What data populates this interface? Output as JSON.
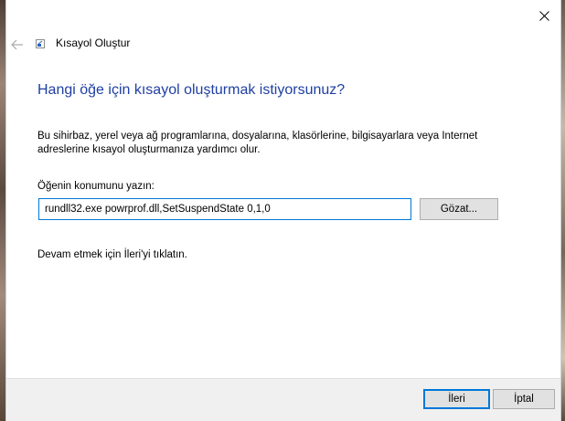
{
  "window": {
    "title": "Kısayol Oluştur"
  },
  "main": {
    "heading": "Hangi öğe için kısayol oluşturmak istiyorsunuz?",
    "description": "Bu sihirbaz, yerel veya ağ programlarına, dosyalarına, klasörlerine, bilgisayarlara veya Internet adreslerine kısayol oluşturmanıza yardımcı olur.",
    "location_label": "Öğenin konumunu yazın:",
    "location_value": "rundll32.exe powrprof.dll,SetSuspendState 0,1,0",
    "browse_label": "Gözat...",
    "hint": "Devam etmek için İleri'yi tıklatın."
  },
  "footer": {
    "next_label": "İleri",
    "cancel_label": "İptal"
  },
  "icons": {
    "close": "close-icon",
    "back": "back-arrow-icon",
    "app": "shortcut-icon"
  },
  "colors": {
    "heading": "#1f3fa3",
    "focus_border": "#0078d7",
    "footer_bg": "#f0f0f0"
  }
}
